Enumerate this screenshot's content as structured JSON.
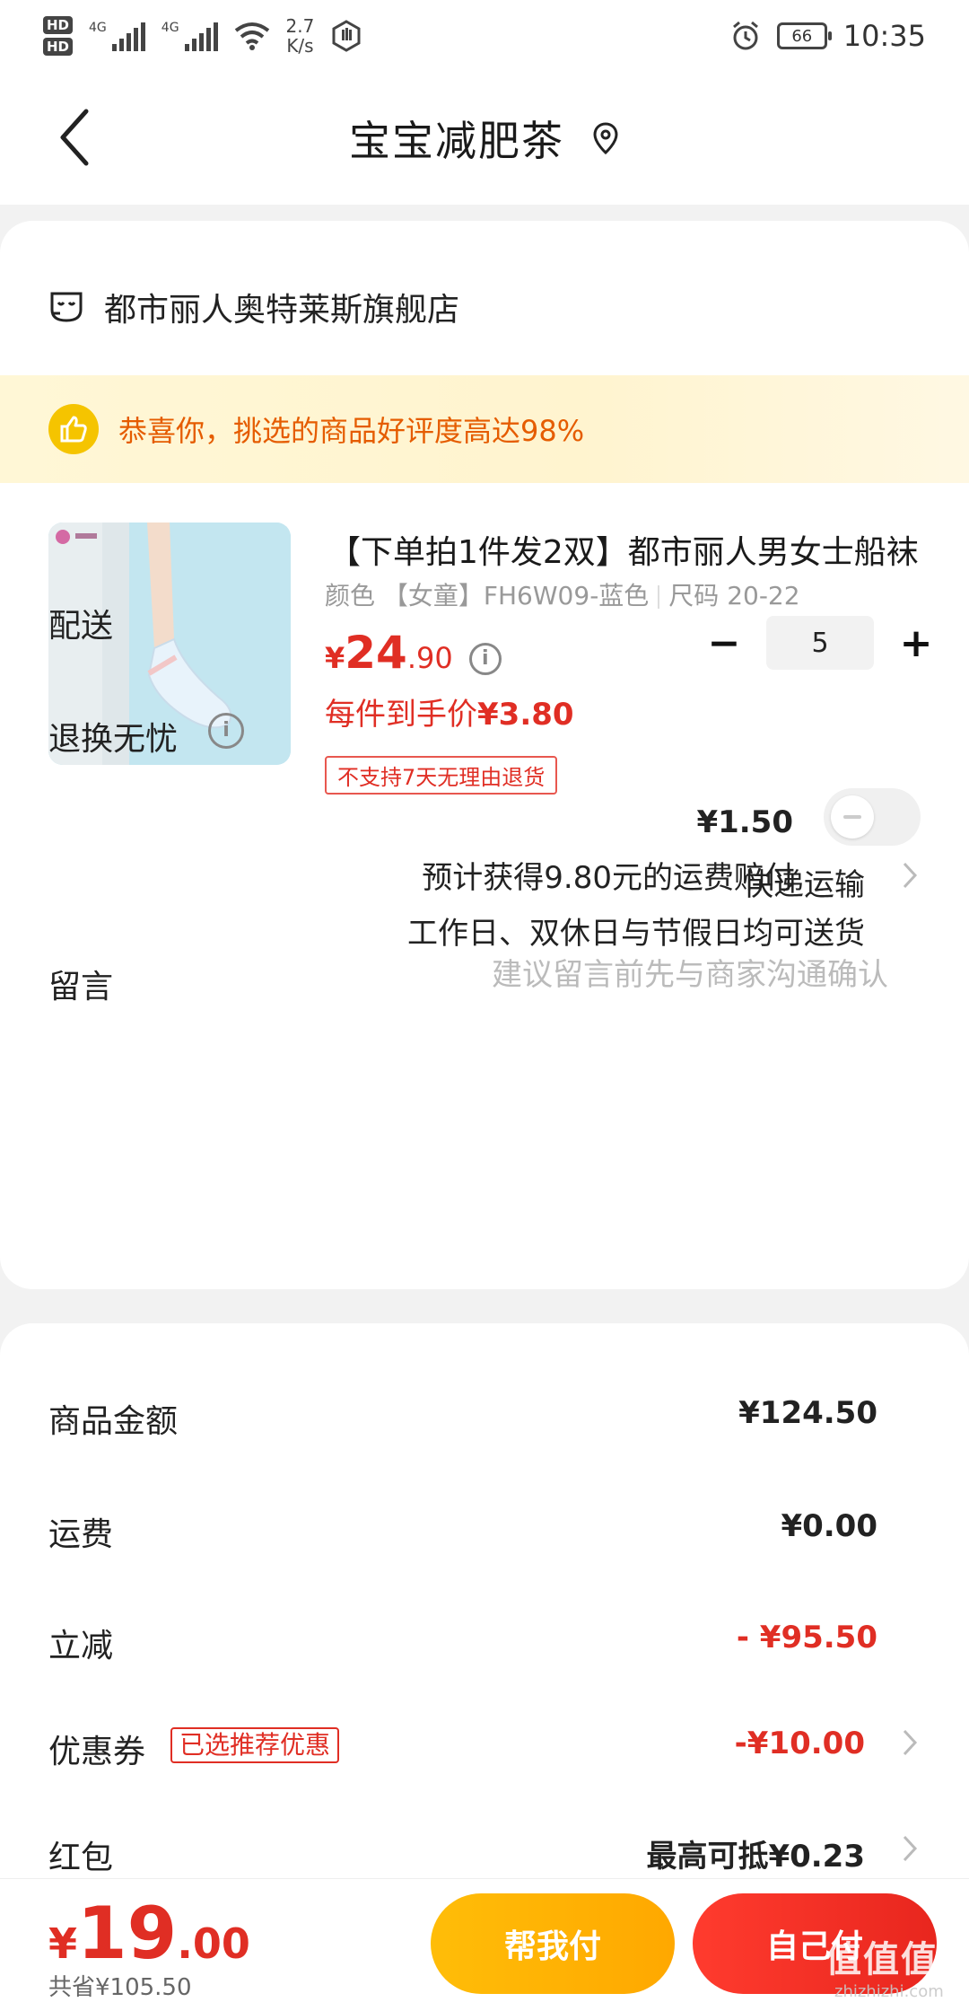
{
  "status_bar": {
    "hd1": "HD",
    "hd2": "HD",
    "net1": "4G",
    "net2": "4G",
    "speed_value": "2.7",
    "speed_unit": "K/s",
    "battery": "66",
    "time": "10:35"
  },
  "nav": {
    "title": "宝宝减肥茶"
  },
  "shop": {
    "name": "都市丽人奥特莱斯旗舰店"
  },
  "praise": {
    "text": "恭喜你，挑选的商品好评度高达98%"
  },
  "product": {
    "title": "【下单拍1件发2双】都市丽人男女士船袜",
    "spec_color": "颜色 【女童】FH6W09-蓝色",
    "spec_size": "尺码 20-22",
    "price_currency": "¥",
    "price_int": "24",
    "price_dec": ".90",
    "quantity": "5",
    "minus": "−",
    "plus": "+",
    "per_piece_label": "每件到手价",
    "per_piece_value": "¥3.80",
    "no_return": "不支持7天无理由退货"
  },
  "delivery": {
    "label": "配送",
    "method": "快递运输",
    "note": "工作日、双休日与节假日均可送货"
  },
  "insurance": {
    "label": "退换无忧",
    "price": "¥1.50",
    "note": "预计获得9.80元的运费赔付",
    "enabled": false
  },
  "message": {
    "label": "留言",
    "placeholder": "建议留言前先与商家沟通确认"
  },
  "summary": {
    "goods_label": "商品金额",
    "goods_value": "¥124.50",
    "shipping_label": "运费",
    "shipping_value": "¥0.00",
    "discount_label": "立减",
    "discount_value": "- ¥95.50",
    "coupon_label": "优惠券",
    "coupon_tag": "已选推荐优惠",
    "coupon_value": "-¥10.00",
    "redpacket_label": "红包",
    "redpacket_value": "最高可抵¥0.23"
  },
  "bottom": {
    "currency": "¥",
    "total_int": "19",
    "total_dec": ".00",
    "saved": "共省¥105.50",
    "help_pay": "帮我付",
    "self_pay": "自己付",
    "watermark": "值值值",
    "watermark_sub": "zhizhizhi.com"
  },
  "colors": {
    "price_red": "#e02e24",
    "praise_orange": "#e55c00",
    "help_btn": "#ffb300",
    "self_btn": "#ef2c22"
  }
}
